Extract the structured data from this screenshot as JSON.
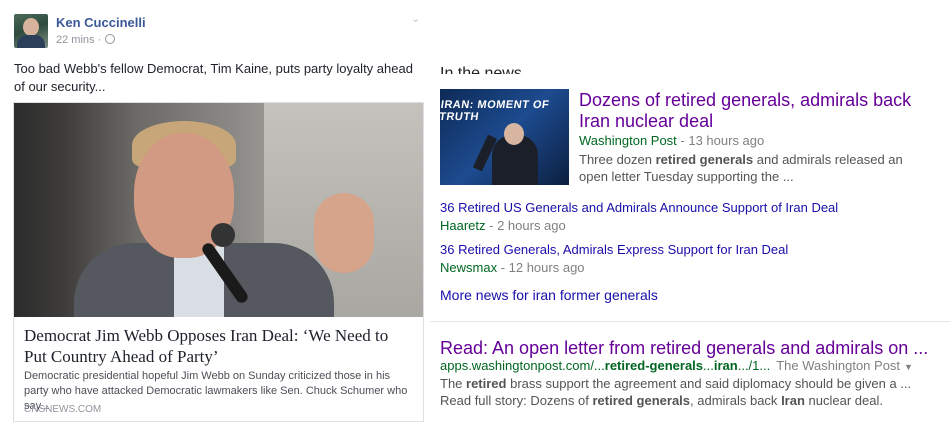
{
  "facebook": {
    "author": "Ken Cuccinelli",
    "time": "22 mins",
    "post_text": "Too bad Webb's fellow Democrat, Tim Kaine, puts party loyalty ahead of our security...",
    "link": {
      "title": "Democrat Jim Webb Opposes Iran Deal: ‘We Need to Put Country Ahead of Party’",
      "description": "Democratic presidential hopeful Jim Webb on Sunday criticized those in his party who have attacked Democratic lawmakers like Sen. Chuck Schumer who say...",
      "source": "CNSNEWS.COM"
    }
  },
  "google": {
    "in_the_news": "In the news",
    "thumb_banner": "IRAN: MOMENT OF TRUTH",
    "top_story": {
      "title": "Dozens of retired generals, admirals back Iran nuclear deal",
      "source": "Washington Post",
      "time": " - 13 hours ago",
      "snippet_before": "Three dozen ",
      "snippet_bold": "retired generals",
      "snippet_after": " and admirals released an open letter Tuesday supporting the ..."
    },
    "items": [
      {
        "title": "36 Retired US Generals and Admirals Announce Support of Iran Deal",
        "source": "Haaretz",
        "time": " - 2 hours ago"
      },
      {
        "title": "36 Retired Generals, Admirals Express Support for Iran Deal",
        "source": "Newsmax",
        "time": " - 12 hours ago"
      }
    ],
    "more_news": "More news for iran former generals",
    "result": {
      "title": "Read: An open letter from retired generals and admirals on ...",
      "url_pre": "apps.washingtonpost.com/...",
      "url_bold1": "retired-generals",
      "url_mid": "...",
      "url_bold2": "iran",
      "url_post": ".../1...",
      "publisher": "The Washington Post",
      "snip_1": "The ",
      "snip_b1": "retired",
      "snip_2": " brass support the agreement and said diplomacy should be given a ... Read full story: Dozens of ",
      "snip_b2": "retired generals",
      "snip_3": ", admirals back ",
      "snip_b3": "Iran",
      "snip_4": " nuclear deal."
    }
  }
}
